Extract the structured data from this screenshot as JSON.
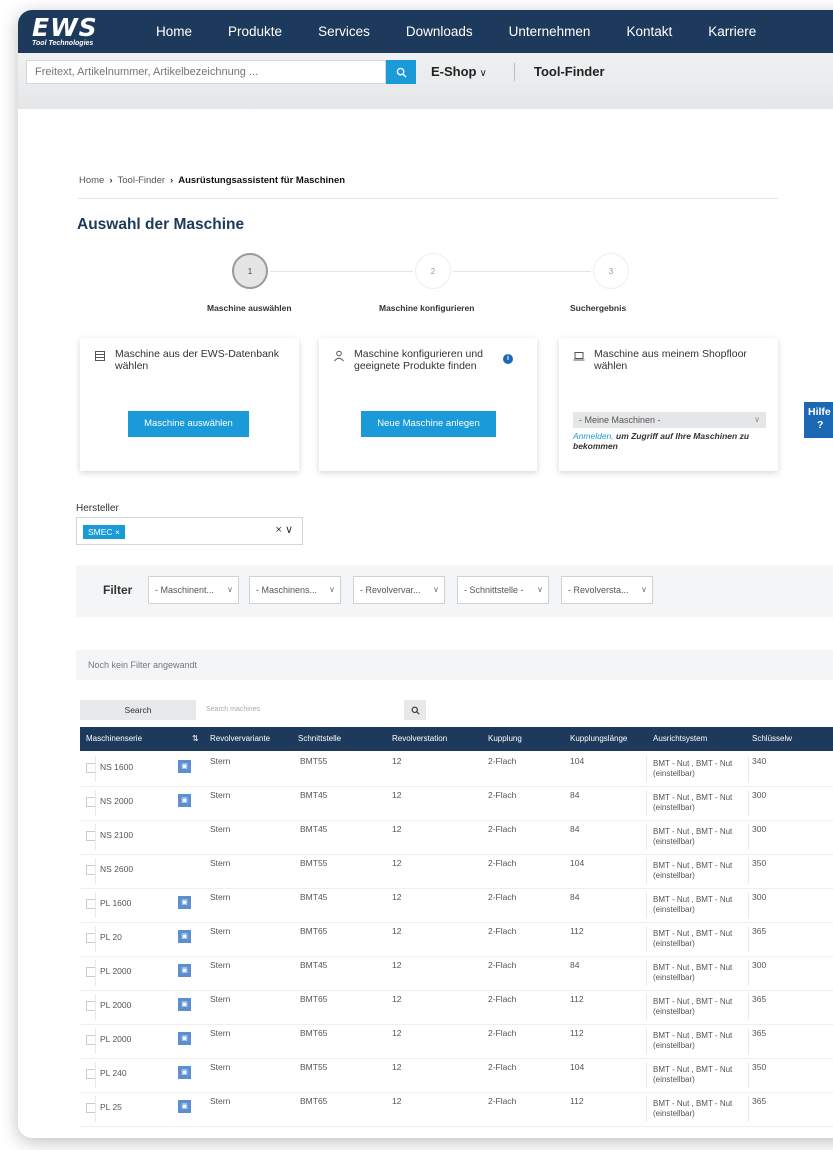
{
  "nav": {
    "logo_main": "EWS",
    "logo_sub": "Tool Technologies",
    "items": [
      "Home",
      "Produkte",
      "Services",
      "Downloads",
      "Unternehmen",
      "Kontakt",
      "Karriere"
    ]
  },
  "search": {
    "placeholder": "Freitext, Artikelnummer, Artikelbezeichnung ...",
    "eshop_label": "E-Shop",
    "toolfinder_label": "Tool-Finder"
  },
  "breadcrumb": {
    "home": "Home",
    "toolfinder": "Tool-Finder",
    "current": "Ausrüstungsassistent für Maschinen"
  },
  "page_title": "Auswahl der Maschine",
  "stepper": {
    "steps": [
      {
        "number": "1",
        "label": "Maschine auswählen"
      },
      {
        "number": "2",
        "label": "Maschine konfigurieren"
      },
      {
        "number": "3",
        "label": "Suchergebnis"
      }
    ]
  },
  "cards": {
    "db": {
      "title_line1": "Maschine aus der EWS-Datenbank",
      "title_line2": "wählen",
      "button": "Maschine auswählen"
    },
    "config": {
      "title_line1": "Maschine konfigurieren und",
      "title_line2": "geeignete Produkte finden",
      "info": "i",
      "button": "Neue Maschine anlegen"
    },
    "shopfloor": {
      "title_line1": "Maschine aus meinem Shopfloor",
      "title_line2": "wählen",
      "select": "- Meine Maschinen -",
      "note_link": "Anmelden,",
      "note_text": " um Zugriff auf Ihre Maschinen zu bekommen"
    }
  },
  "hilfe": {
    "label": "Hilfe",
    "q": "?"
  },
  "hersteller": {
    "label": "Hersteller",
    "chip": "SMEC ×",
    "controls": "×∨"
  },
  "filter": {
    "label": "Filter",
    "selects": [
      "- Maschinent...",
      "- Maschinens...",
      "- Revolvervar...",
      "- Schnittstelle -",
      "- Revolversta..."
    ]
  },
  "nofilter": "Noch kein Filter angewandt",
  "table_search": {
    "button": "Search",
    "placeholder": "Search machines"
  },
  "table": {
    "headers": [
      "Maschinenserie",
      "⇅",
      "Revolvervariante",
      "Schnittstelle",
      "Revolverstation",
      "Kupplung",
      "Kupplungslänge",
      "Ausrichtsystem",
      "Schlüsselw"
    ],
    "rows": [
      {
        "serie": "NS 1600",
        "badge": true,
        "variante": "Stern",
        "schnittstelle": "BMT55",
        "station": "12",
        "kupplung": "2-Flach",
        "laenge": "104",
        "ausricht1": "BMT - Nut , BMT - Nut",
        "ausricht2": "(einstellbar)",
        "schluessel": "340"
      },
      {
        "serie": "NS 2000",
        "badge": true,
        "variante": "Stern",
        "schnittstelle": "BMT45",
        "station": "12",
        "kupplung": "2-Flach",
        "laenge": "84",
        "ausricht1": "BMT - Nut , BMT - Nut",
        "ausricht2": "(einstellbar)",
        "schluessel": "300"
      },
      {
        "serie": "NS 2100",
        "badge": false,
        "variante": "Stern",
        "schnittstelle": "BMT45",
        "station": "12",
        "kupplung": "2-Flach",
        "laenge": "84",
        "ausricht1": "BMT - Nut , BMT - Nut",
        "ausricht2": "(einstellbar)",
        "schluessel": "300"
      },
      {
        "serie": "NS 2600",
        "badge": false,
        "variante": "Stern",
        "schnittstelle": "BMT55",
        "station": "12",
        "kupplung": "2-Flach",
        "laenge": "104",
        "ausricht1": "BMT - Nut , BMT - Nut",
        "ausricht2": "(einstellbar)",
        "schluessel": "350"
      },
      {
        "serie": "PL 1600",
        "badge": true,
        "variante": "Stern",
        "schnittstelle": "BMT45",
        "station": "12",
        "kupplung": "2-Flach",
        "laenge": "84",
        "ausricht1": "BMT - Nut , BMT - Nut",
        "ausricht2": "(einstellbar)",
        "schluessel": "300"
      },
      {
        "serie": "PL 20",
        "badge": true,
        "variante": "Stern",
        "schnittstelle": "BMT65",
        "station": "12",
        "kupplung": "2-Flach",
        "laenge": "112",
        "ausricht1": "BMT - Nut , BMT - Nut",
        "ausricht2": "(einstellbar)",
        "schluessel": "365"
      },
      {
        "serie": "PL 2000",
        "badge": true,
        "variante": "Stern",
        "schnittstelle": "BMT45",
        "station": "12",
        "kupplung": "2-Flach",
        "laenge": "84",
        "ausricht1": "BMT - Nut , BMT - Nut",
        "ausricht2": "(einstellbar)",
        "schluessel": "300"
      },
      {
        "serie": "PL 2000",
        "badge": true,
        "variante": "Stern",
        "schnittstelle": "BMT65",
        "station": "12",
        "kupplung": "2-Flach",
        "laenge": "112",
        "ausricht1": "BMT - Nut , BMT - Nut",
        "ausricht2": "(einstellbar)",
        "schluessel": "365"
      },
      {
        "serie": "PL 2000",
        "badge": true,
        "variante": "Stern",
        "schnittstelle": "BMT65",
        "station": "12",
        "kupplung": "2-Flach",
        "laenge": "112",
        "ausricht1": "BMT - Nut , BMT - Nut",
        "ausricht2": "(einstellbar)",
        "schluessel": "365"
      },
      {
        "serie": "PL 240",
        "badge": true,
        "variante": "Stern",
        "schnittstelle": "BMT55",
        "station": "12",
        "kupplung": "2-Flach",
        "laenge": "104",
        "ausricht1": "BMT - Nut , BMT - Nut",
        "ausricht2": "(einstellbar)",
        "schluessel": "350"
      },
      {
        "serie": "PL 25",
        "badge": true,
        "variante": "Stern",
        "schnittstelle": "BMT65",
        "station": "12",
        "kupplung": "2-Flach",
        "laenge": "112",
        "ausricht1": "BMT - Nut , BMT - Nut",
        "ausricht2": "(einstellbar)",
        "schluessel": "365"
      }
    ]
  }
}
